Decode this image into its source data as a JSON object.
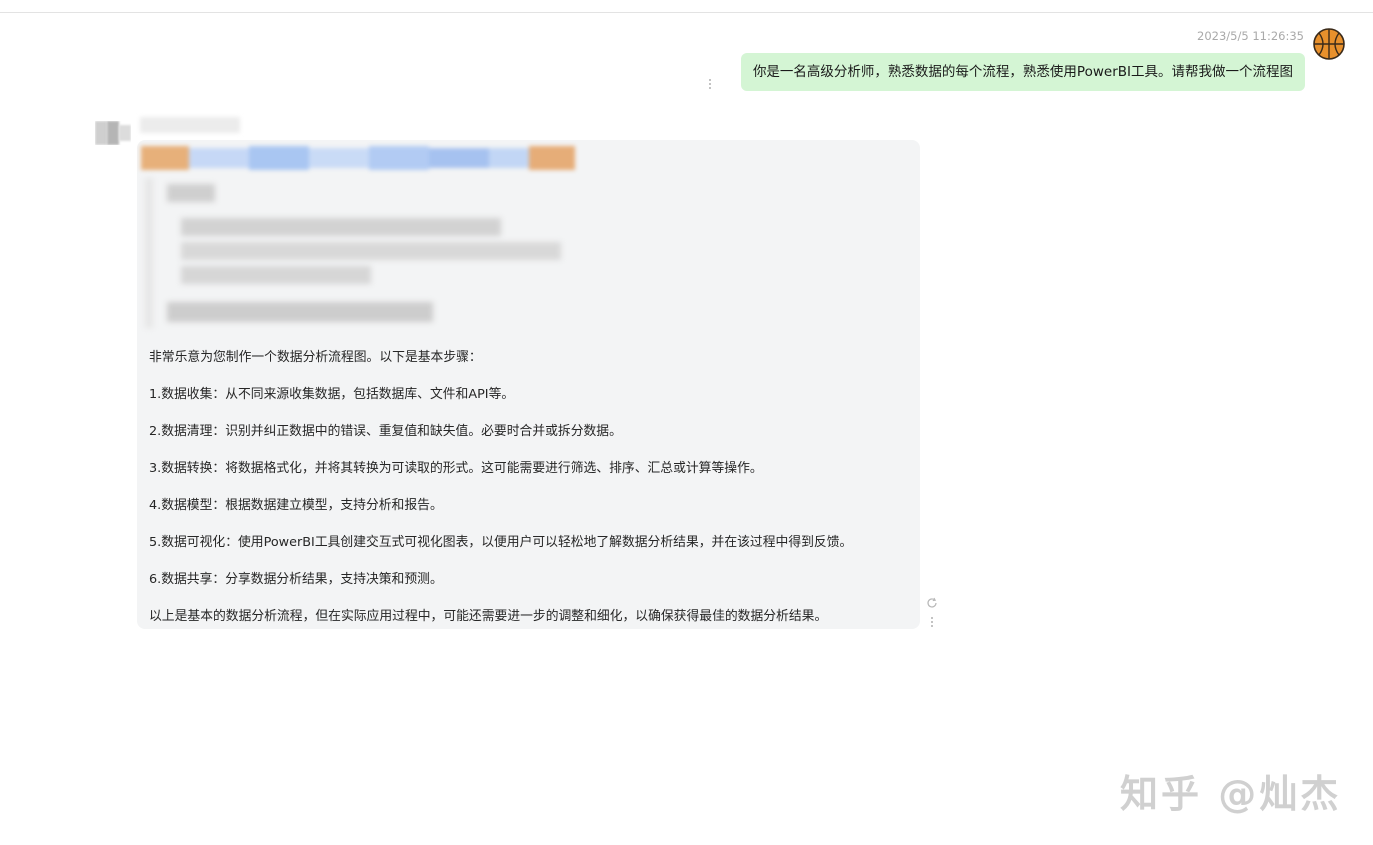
{
  "user_message": {
    "timestamp": "2023/5/5 11:26:35",
    "text": "你是一名高级分析师，熟悉数据的每个流程，熟悉使用PowerBI工具。请帮我做一个流程图",
    "avatar_icon": "basketball-icon"
  },
  "bot_message": {
    "paragraphs": [
      "非常乐意为您制作一个数据分析流程图。以下是基本步骤：",
      "1.数据收集：从不同来源收集数据，包括数据库、文件和API等。",
      "2.数据清理：识别并纠正数据中的错误、重复值和缺失值。必要时合并或拆分数据。",
      "3.数据转换：将数据格式化，并将其转换为可读取的形式。这可能需要进行筛选、排序、汇总或计算等操作。",
      "4.数据模型：根据数据建立模型，支持分析和报告。",
      "5.数据可视化：使用PowerBI工具创建交互式可视化图表，以便用户可以轻松地了解数据分析结果，并在该过程中得到反馈。",
      "6.数据共享：分享数据分析结果，支持决策和预测。",
      "以上是基本的数据分析流程，但在实际应用过程中，可能还需要进一步的调整和细化，以确保获得最佳的数据分析结果。"
    ]
  },
  "watermark": "知乎 @灿杰",
  "colors": {
    "user_bubble": "#d4f5d4",
    "bot_card": "#f3f4f5",
    "avatar_orange": "#e8902c"
  }
}
